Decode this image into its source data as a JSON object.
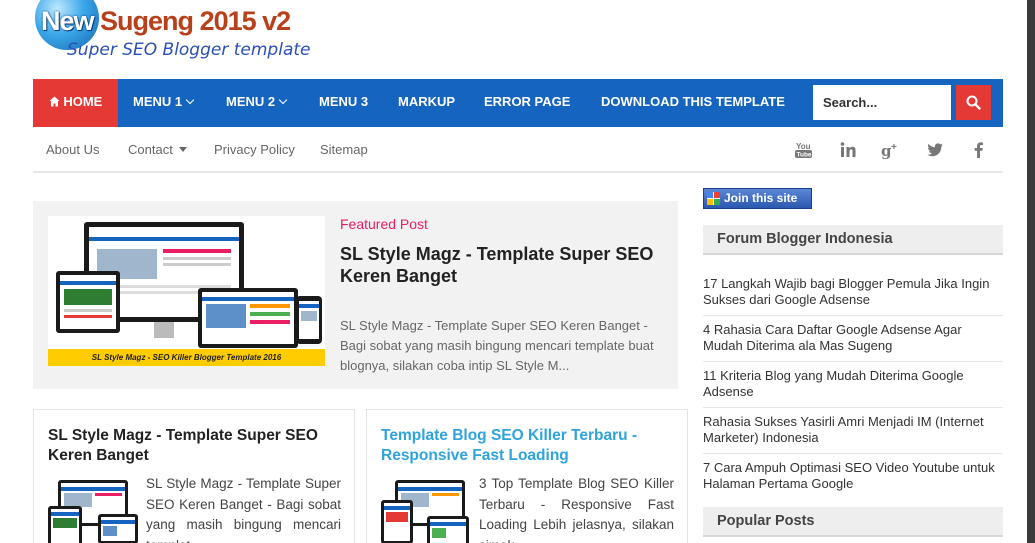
{
  "logo": {
    "word1": "New",
    "word2": "Sugeng",
    "word3": "2015 v2",
    "tagline": "Super SEO Blogger template"
  },
  "nav": {
    "items": [
      {
        "label": "HOME",
        "icon": "home-icon"
      },
      {
        "label": "MENU 1"
      },
      {
        "label": "MENU 2"
      },
      {
        "label": "MENU 3"
      },
      {
        "label": "MARKUP"
      },
      {
        "label": "ERROR PAGE"
      },
      {
        "label": "DOWNLOAD THIS TEMPLATE"
      }
    ],
    "search_placeholder": "Search...",
    "search_icon": "search-icon"
  },
  "subnav": {
    "items": [
      "About Us",
      "Contact",
      "Privacy Policy",
      "Sitemap"
    ],
    "social": [
      "youtube-icon",
      "linkedin-icon",
      "google-plus-icon",
      "twitter-icon",
      "facebook-icon"
    ]
  },
  "featured": {
    "label": "Featured Post",
    "title": "SL Style Magz - Template Super SEO Keren Banget",
    "excerpt": "SL Style Magz - Template Super SEO Keren Banget - Bagi sobat yang masih bingung mencari template buat blognya, silakan coba intip SL Style M...",
    "banner": "SL Style Magz - SEO Killer Blogger Template 2016"
  },
  "posts": [
    {
      "title": "SL Style Magz - Template Super SEO Keren Banget",
      "excerpt": "SL Style Magz - Template Super SEO Keren Banget - Bagi sobat yang masih bingung mencari templat"
    },
    {
      "title": "Template Blog SEO Killer Terbaru - Responsive Fast Loading",
      "excerpt": "3 Top Template Blog SEO Killer Terbaru - Responsive Fast Loading Lebih jelasnya, silakan simak"
    }
  ],
  "sidebar": {
    "join_label": "Join this site",
    "widget1_title": "Forum Blogger Indonesia",
    "links": [
      "17 Langkah Wajib bagi Blogger Pemula Jika Ingin Sukses dari Google Adsense",
      "4 Rahasia Cara Daftar Google Adsense Agar Mudah Diterima ala Mas Sugeng",
      "11 Kriteria Blog yang Mudah Diterima Google Adsense",
      "Rahasia Sukses Yasirli Amri Menjadi IM (Internet Marketer) Indonesia",
      "7 Cara Ampuh Optimasi SEO Video Youtube untuk Halaman Pertama Google"
    ],
    "widget2_title": "Popular Posts"
  },
  "colors": {
    "nav_bg": "#1565c0",
    "accent_red": "#e53935",
    "featured_label": "#e91e63",
    "link_blue": "#2ea3dc"
  }
}
